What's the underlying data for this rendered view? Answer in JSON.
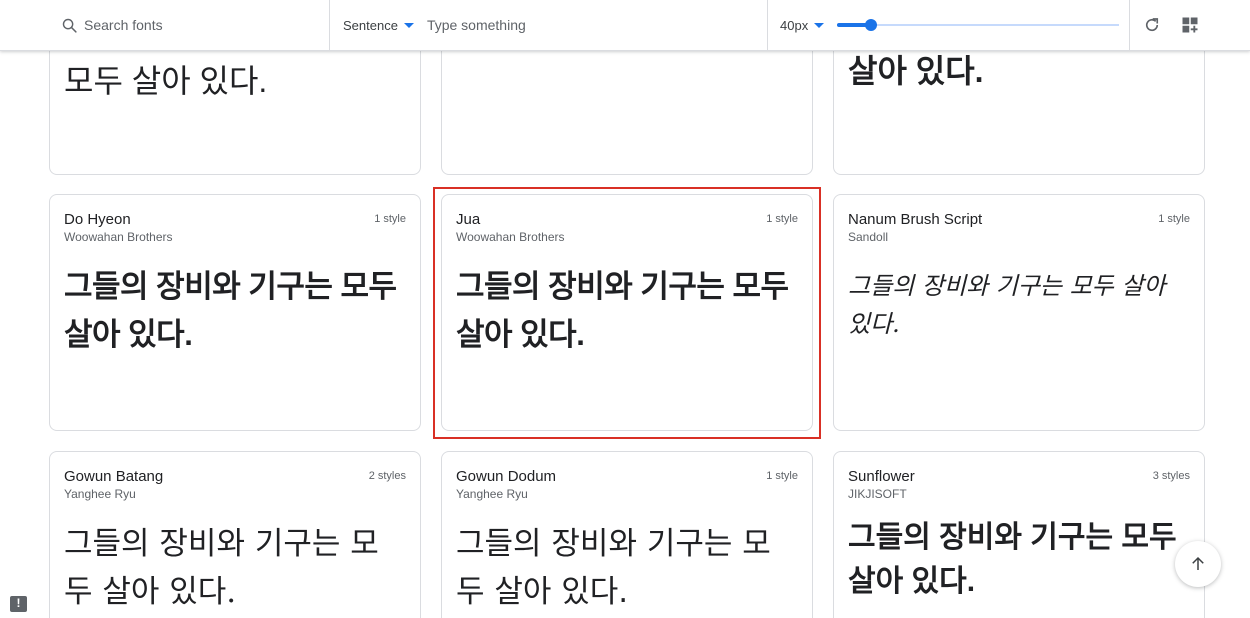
{
  "toolbar": {
    "search_placeholder": "Search fonts",
    "preview_mode": "Sentence",
    "preview_placeholder": "Type something",
    "font_size": "40px",
    "font_size_slider_fraction": 0.12
  },
  "top_row": [
    {
      "sample": "모두 살아 있다."
    },
    {
      "sample": ""
    },
    {
      "sample": "살아 있다."
    }
  ],
  "fonts": [
    {
      "name": "Do Hyeon",
      "author": "Woowahan Brothers",
      "styles": "1 style",
      "sample": "그들의 장비와 기구는 모두 살아 있다."
    },
    {
      "name": "Jua",
      "author": "Woowahan Brothers",
      "styles": "1 style",
      "sample": "그들의 장비와 기구는 모두 살아 있다."
    },
    {
      "name": "Nanum Brush Script",
      "author": "Sandoll",
      "styles": "1 style",
      "sample": "그들의 장비와 기구는 모두 살아 있다."
    },
    {
      "name": "Gowun Batang",
      "author": "Yanghee Ryu",
      "styles": "2 styles",
      "sample": "그들의 장비와 기구는 모두 살아 있다."
    },
    {
      "name": "Gowun Dodum",
      "author": "Yanghee Ryu",
      "styles": "1 style",
      "sample": "그들의 장비와 기구는 모두 살아 있다."
    },
    {
      "name": "Sunflower",
      "author": "JIKJISOFT",
      "styles": "3 styles",
      "sample": "그들의 장비와 기구는 모두 살아 있다."
    }
  ],
  "colors": {
    "accent": "#1a73e8",
    "highlight": "#d93025",
    "border": "#dadce0"
  },
  "icons": [
    "search-icon",
    "caret-down-icon",
    "refresh-icon",
    "add-grid-icon",
    "arrow-up-icon",
    "feedback-icon"
  ]
}
